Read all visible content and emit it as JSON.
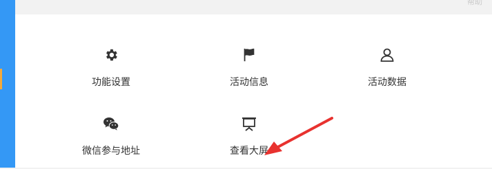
{
  "hint": "帮助",
  "tiles": [
    {
      "label": "功能设置",
      "icon": "gear-icon"
    },
    {
      "label": "活动信息",
      "icon": "flag-icon"
    },
    {
      "label": "活动数据",
      "icon": "user-icon"
    },
    {
      "label": "微信参与地址",
      "icon": "wechat-icon"
    },
    {
      "label": "查看大屏",
      "icon": "presentation-icon"
    }
  ],
  "colors": {
    "sidebar": "#3498f5",
    "sidebar_marker": "#f3a93a",
    "arrow": "#e8322f",
    "icon": "#333333"
  }
}
